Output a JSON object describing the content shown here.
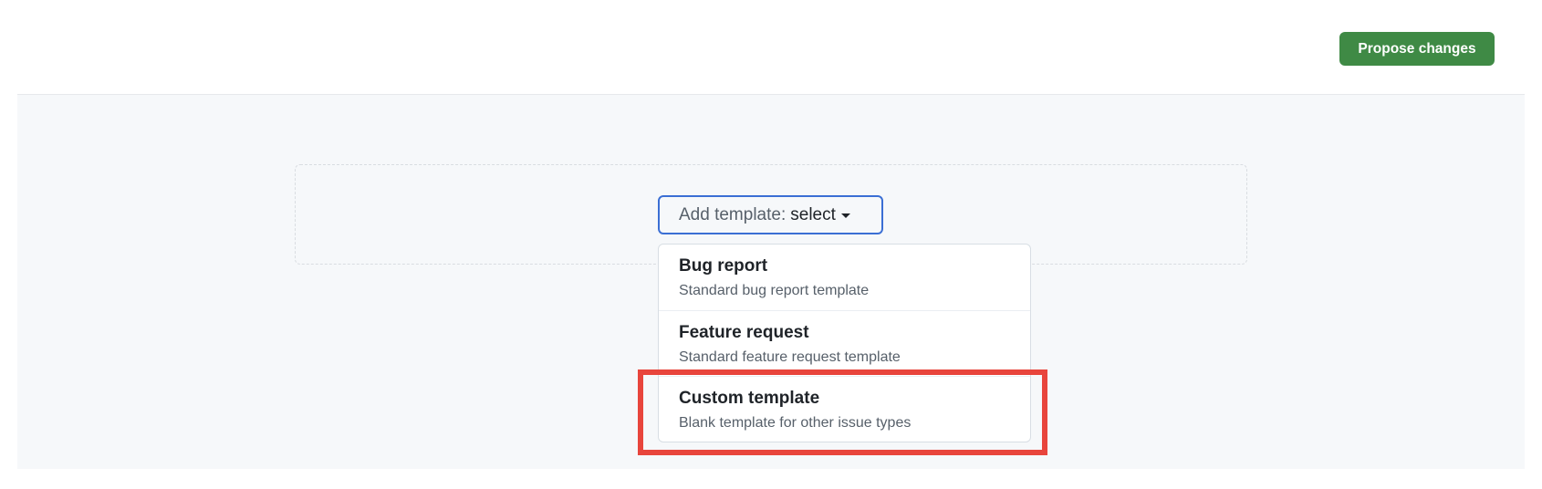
{
  "header": {
    "propose_label": "Propose changes",
    "accent_color": "#3f8a45"
  },
  "template_picker": {
    "prefix": "Add template:",
    "selected": "select",
    "caret_icon": "caret-down-icon",
    "focus_color": "#3b6fd4"
  },
  "menu": {
    "items": [
      {
        "title": "Bug report",
        "description": "Standard bug report template"
      },
      {
        "title": "Feature request",
        "description": "Standard feature request template"
      },
      {
        "title": "Custom template",
        "description": "Blank template for other issue types"
      }
    ]
  },
  "annotation": {
    "highlight_color": "#e8453c",
    "highlighted_item": "Custom template"
  }
}
